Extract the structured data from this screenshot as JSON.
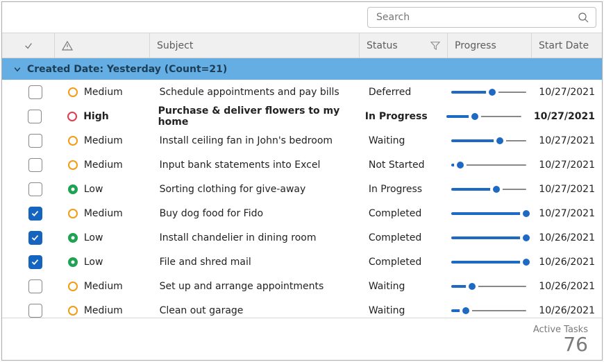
{
  "search": {
    "placeholder": "Search"
  },
  "columns": {
    "subject": "Subject",
    "status": "Status",
    "progress": "Progress",
    "start": "Start Date"
  },
  "group": {
    "label": "Created Date: Yesterday (Count=21)"
  },
  "rows": [
    {
      "checked": false,
      "priority": "Medium",
      "priorityColor": "#f39c12",
      "subject": "Schedule appointments and pay bills",
      "status": "Deferred",
      "progress": 55,
      "start": "10/27/2021",
      "bold": false
    },
    {
      "checked": false,
      "priority": "High",
      "priorityColor": "#e23b4b",
      "subject": "Purchase & deliver flowers to my home",
      "status": "In Progress",
      "progress": 38,
      "start": "10/27/2021",
      "bold": true
    },
    {
      "checked": false,
      "priority": "Medium",
      "priorityColor": "#f39c12",
      "subject": "Install ceiling fan in John's bedroom",
      "status": "Waiting",
      "progress": 65,
      "start": "10/27/2021",
      "bold": false
    },
    {
      "checked": false,
      "priority": "Medium",
      "priorityColor": "#f39c12",
      "subject": "Input bank statements into Excel",
      "status": "Not Started",
      "progress": 12,
      "start": "10/27/2021",
      "bold": false
    },
    {
      "checked": false,
      "priority": "Low",
      "priorityColor": "#1fa352",
      "subject": "Sorting clothing for give-away",
      "status": "In Progress",
      "progress": 60,
      "start": "10/27/2021",
      "bold": false
    },
    {
      "checked": true,
      "priority": "Medium",
      "priorityColor": "#f39c12",
      "subject": "Buy dog food for Fido",
      "status": "Completed",
      "progress": 100,
      "start": "10/27/2021",
      "bold": false
    },
    {
      "checked": true,
      "priority": "Low",
      "priorityColor": "#1fa352",
      "subject": "Install chandelier in dining room",
      "status": "Completed",
      "progress": 100,
      "start": "10/26/2021",
      "bold": false
    },
    {
      "checked": true,
      "priority": "Low",
      "priorityColor": "#1fa352",
      "subject": "File and shred mail",
      "status": "Completed",
      "progress": 100,
      "start": "10/26/2021",
      "bold": false
    },
    {
      "checked": false,
      "priority": "Medium",
      "priorityColor": "#f39c12",
      "subject": "Set up and arrange appointments",
      "status": "Waiting",
      "progress": 28,
      "start": "10/26/2021",
      "bold": false
    },
    {
      "checked": false,
      "priority": "Medium",
      "priorityColor": "#f39c12",
      "subject": "Clean out garage",
      "status": "Waiting",
      "progress": 20,
      "start": "10/26/2021",
      "bold": false
    }
  ],
  "footer": {
    "label": "Active Tasks",
    "count": "76"
  }
}
